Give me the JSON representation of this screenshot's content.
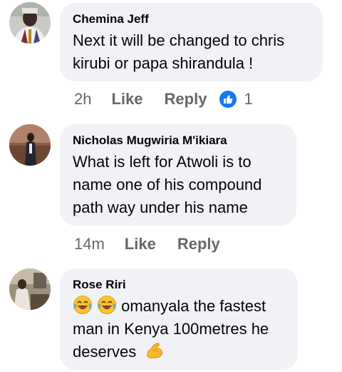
{
  "comments": [
    {
      "author": "Chemina Jeff",
      "lines": [
        "Next it will be changed to chris",
        "kirubi or papa shirandula !"
      ],
      "time": "2h",
      "like": "Like",
      "reply": "Reply",
      "reaction_icon": "like-thumb-icon",
      "reaction_count": "1"
    },
    {
      "author": "Nicholas Mugwiria M'ikiara",
      "lines": [
        "What is left for Atwoli is to",
        "name one of his compound",
        "path way under his name"
      ],
      "time": "14m",
      "like": "Like",
      "reply": "Reply"
    },
    {
      "author": "Rose Riri",
      "line1_text": " omanyala the fastest",
      "lines": [
        "man in Kenya 100metres he",
        "deserves"
      ],
      "emojis": [
        "laughing-tears-emoji",
        "laughing-tears-emoji",
        "flexed-biceps-emoji"
      ]
    }
  ],
  "colors": {
    "bubble": "#f0f2f5",
    "meta_text": "#65676b",
    "like_blue": "#1877f2"
  }
}
